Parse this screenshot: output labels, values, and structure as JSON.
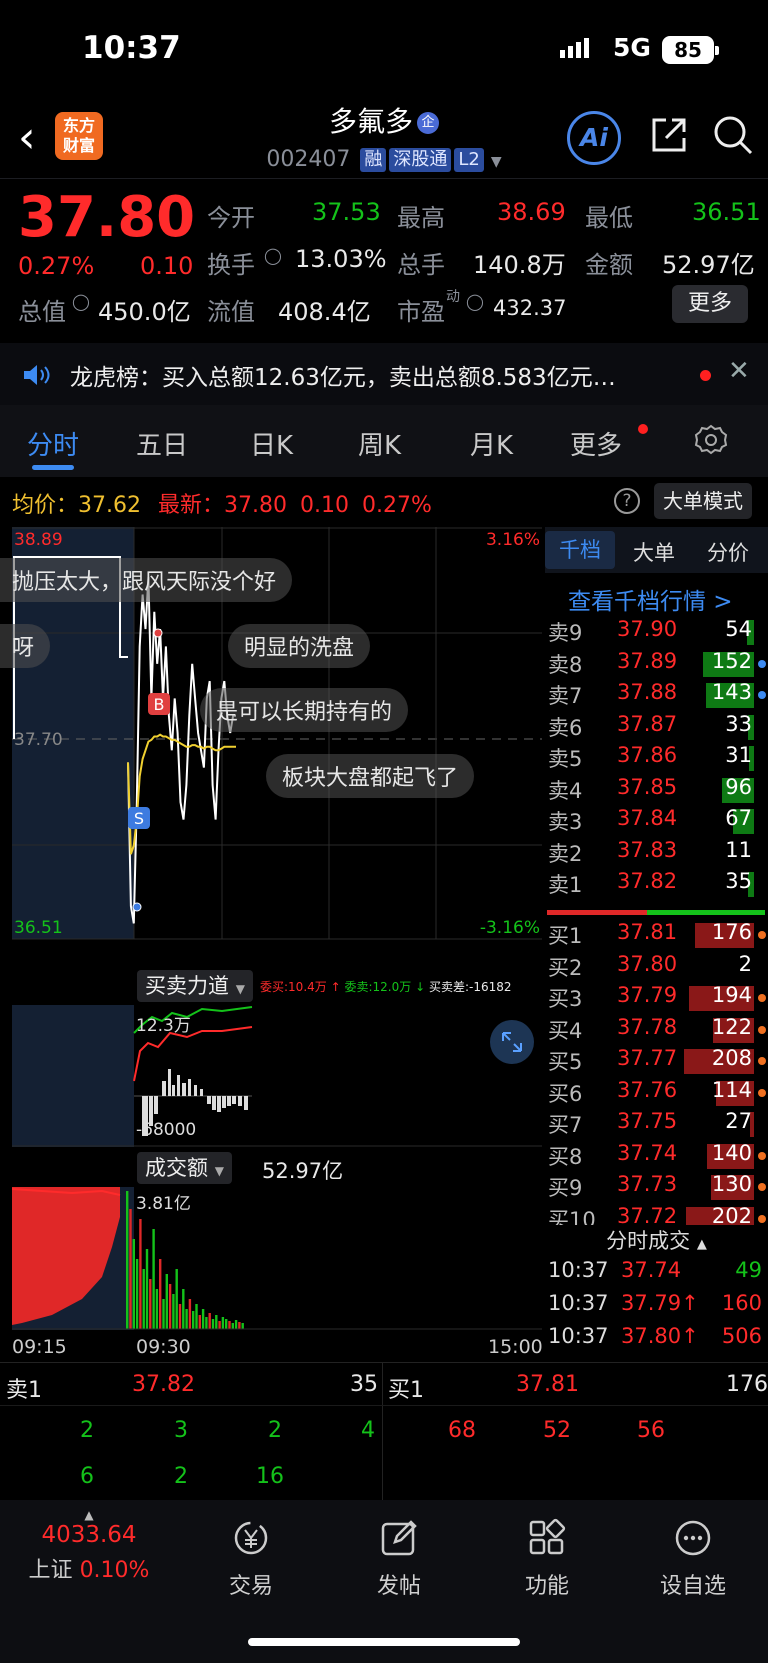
{
  "status_bar": {
    "time": "10:37",
    "network": "5G",
    "battery": "85"
  },
  "header": {
    "stock_name": "多氟多",
    "badge": "企",
    "code": "002407",
    "tags": [
      "融",
      "深股通",
      "L2"
    ],
    "logo_text_1": "东方",
    "logo_text_2": "财富",
    "ai_label": "Ai"
  },
  "quote": {
    "price": "37.80",
    "change_pct": "0.27%",
    "change": "0.10",
    "open_label": "今开",
    "open": "37.53",
    "high_label": "最高",
    "high": "38.69",
    "low_label": "最低",
    "low": "36.51",
    "turnover_label": "换手",
    "turnover": "13.03%",
    "volume_label": "总手",
    "volume": "140.8万",
    "amount_label": "金额",
    "amount": "52.97亿",
    "mktcap_label": "总值",
    "mktcap": "450.0亿",
    "float_label": "流值",
    "float_cap": "408.4亿",
    "pe_label": "市盈",
    "pe_super": "动",
    "pe": "432.37",
    "more_button": "更多"
  },
  "notice": {
    "text": "龙虎榜：买入总额12.63亿元，卖出总额8.583亿元…"
  },
  "tabs": [
    "分时",
    "五日",
    "日K",
    "周K",
    "月K",
    "更多"
  ],
  "chart_header": {
    "avg_label": "均价：",
    "avg": "37.62",
    "latest_label": "最新：",
    "latest": "37.80",
    "latest_change": "0.10",
    "latest_pct": "0.27%",
    "big_order_mode": "大单模式"
  },
  "chart_data": {
    "type": "line",
    "title": "",
    "price_axis": {
      "max": "38.89",
      "mid": "37.70",
      "min": "36.51"
    },
    "pct_axis": {
      "max": "3.16%",
      "min": "-3.16%"
    },
    "time_axis": [
      "09:15",
      "09:30",
      "15:00"
    ],
    "ylim": [
      36.51,
      38.89
    ],
    "series": [
      {
        "values": [
          37.53,
          36.7,
          36.6,
          37.3,
          38.2,
          38.5,
          38.3,
          38.6,
          37.9,
          38.4,
          38.1,
          38.3,
          37.9,
          38.2,
          37.8,
          37.6,
          37.9,
          37.7,
          37.3,
          37.2,
          37.4,
          37.8,
          38.1,
          37.9,
          37.7,
          37.6,
          37.5,
          37.9,
          38.0,
          37.4,
          37.2,
          37.6,
          37.9,
          38.0,
          37.8,
          37.7,
          37.8,
          37.8
        ]
      },
      {
        "values": [
          37.53,
          37.0,
          37.05,
          37.2,
          37.45,
          37.55,
          37.6,
          37.65,
          37.66,
          37.68,
          37.68,
          37.69,
          37.68,
          37.68,
          37.67,
          37.66,
          37.66,
          37.65,
          37.64,
          37.63,
          37.62,
          37.62,
          37.63,
          37.63,
          37.62,
          37.62,
          37.61,
          37.62,
          37.62,
          37.61,
          37.6,
          37.6,
          37.61,
          37.62,
          37.62,
          37.62,
          37.62,
          37.62
        ]
      }
    ],
    "markers": {
      "buy": "B",
      "sell": "S"
    }
  },
  "comments": [
    "抛压太大，跟风天际没个好",
    "呀",
    "明显的洗盘",
    "是可以长期持有的",
    "板块大盘都起飞了"
  ],
  "flow": {
    "label": "买卖力道",
    "wei_buy": "委买:10.4万",
    "wei_sell": "委卖:12.0万",
    "diff": "买卖差:-16182",
    "top": "12.3万",
    "bottom": "-68000"
  },
  "amount_chart": {
    "label": "成交额",
    "total": "52.97亿",
    "peak": "3.81亿"
  },
  "order_tabs": [
    "千档",
    "大单",
    "分价"
  ],
  "depth_link": "查看千档行情 >",
  "sells": [
    {
      "label": "卖9",
      "price": "37.90",
      "vol": "54",
      "w": 0.1
    },
    {
      "label": "卖8",
      "price": "37.89",
      "vol": "152",
      "w": 0.73
    },
    {
      "label": "卖7",
      "price": "37.88",
      "vol": "143",
      "w": 0.69
    },
    {
      "label": "卖6",
      "price": "37.87",
      "vol": "33",
      "w": 0.08
    },
    {
      "label": "卖5",
      "price": "37.86",
      "vol": "31",
      "w": 0.07
    },
    {
      "label": "卖4",
      "price": "37.85",
      "vol": "96",
      "w": 0.46
    },
    {
      "label": "卖3",
      "price": "37.84",
      "vol": "67",
      "w": 0.3
    },
    {
      "label": "卖2",
      "price": "37.83",
      "vol": "11",
      "w": 0.0
    },
    {
      "label": "卖1",
      "price": "37.82",
      "vol": "35",
      "w": 0.08
    }
  ],
  "buys": [
    {
      "label": "买1",
      "price": "37.81",
      "vol": "176",
      "w": 0.85
    },
    {
      "label": "买2",
      "price": "37.80",
      "vol": "2",
      "w": 0.0
    },
    {
      "label": "买3",
      "price": "37.79",
      "vol": "194",
      "w": 0.93
    },
    {
      "label": "买4",
      "price": "37.78",
      "vol": "122",
      "w": 0.59
    },
    {
      "label": "买5",
      "price": "37.77",
      "vol": "208",
      "w": 1.0
    },
    {
      "label": "买6",
      "price": "37.76",
      "vol": "114",
      "w": 0.55
    },
    {
      "label": "买7",
      "price": "37.75",
      "vol": "27",
      "w": 0.06
    },
    {
      "label": "买8",
      "price": "37.74",
      "vol": "140",
      "w": 0.67
    },
    {
      "label": "买9",
      "price": "37.73",
      "vol": "130",
      "w": 0.62
    },
    {
      "label": "买10",
      "price": "37.72",
      "vol": "202",
      "w": 0.97
    }
  ],
  "ticks_label": "分时成交",
  "ticks": [
    {
      "time": "10:37",
      "price": "37.74",
      "vol": "49"
    },
    {
      "time": "10:37",
      "price": "37.79↑",
      "vol": "160"
    },
    {
      "time": "10:37",
      "price": "37.80↑",
      "vol": "506"
    }
  ],
  "book": {
    "sell_label": "卖1",
    "sell_price": "37.82",
    "sell_vol": "35",
    "buy_label": "买1",
    "buy_price": "37.81",
    "buy_vol": "176",
    "sell_queue": [
      "2",
      "3",
      "2",
      "4",
      "6",
      "2",
      "16"
    ],
    "buy_queue": [
      "68",
      "52",
      "56"
    ]
  },
  "nav": {
    "index_value": "4033.64",
    "index_name": "上证",
    "index_pct": "0.10%",
    "items": [
      "交易",
      "发帖",
      "功能",
      "设自选"
    ]
  },
  "colors": {
    "up": "#ff2b2b",
    "down": "#14c21a",
    "accent": "#3d8bf2"
  }
}
